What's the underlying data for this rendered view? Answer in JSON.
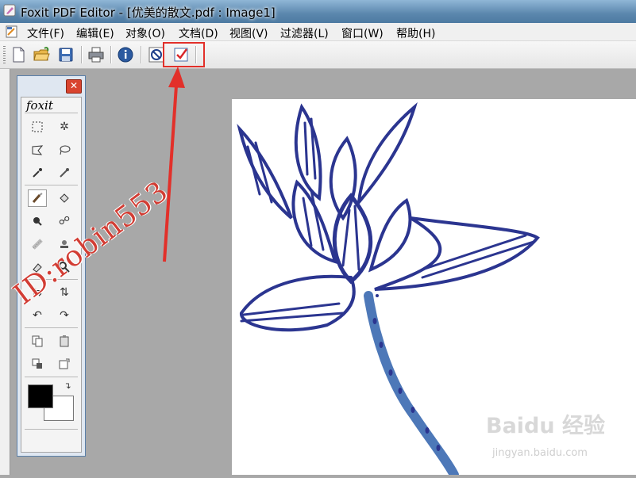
{
  "window": {
    "title": "Foxit PDF Editor - [优美的散文.pdf : Image1]"
  },
  "menu": [
    {
      "label": "文件(F)"
    },
    {
      "label": "编辑(E)"
    },
    {
      "label": "对象(O)"
    },
    {
      "label": "文档(D)"
    },
    {
      "label": "视图(V)"
    },
    {
      "label": "过滤器(L)"
    },
    {
      "label": "窗口(W)"
    },
    {
      "label": "帮助(H)"
    }
  ],
  "toolbar": {
    "buttons": [
      "new-document-icon",
      "open-folder-icon",
      "save-icon",
      "print-icon",
      "info-icon",
      "cancel-circle-icon",
      "checkbox-check-icon"
    ]
  },
  "palette": {
    "brand": "foxit",
    "close_glyph": "✕"
  },
  "watermark": {
    "text": "ID:robin553"
  },
  "site_watermark": {
    "logo_text": "Baidu 经验",
    "url": "jingyan.baidu.com"
  },
  "colors": {
    "highlight": "#e2302a",
    "arrow": "#e2302a",
    "lotus": "#2b3590",
    "stem": "#4d78b8"
  }
}
